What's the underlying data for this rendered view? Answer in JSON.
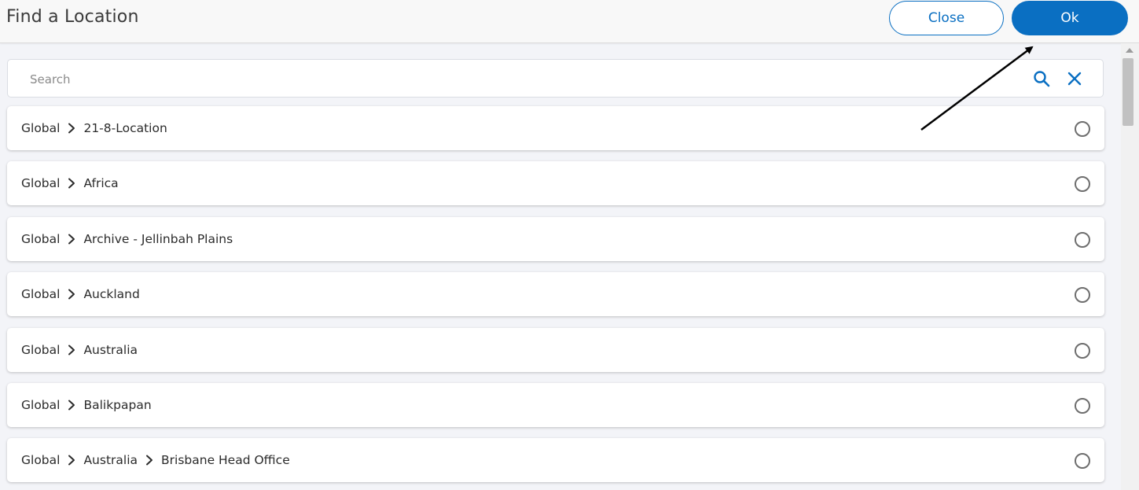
{
  "header": {
    "title": "Find a Location",
    "close_label": "Close",
    "ok_label": "Ok"
  },
  "search": {
    "placeholder": "Search",
    "value": "",
    "search_icon": "search-icon",
    "clear_icon": "close-icon"
  },
  "locations": [
    {
      "path": [
        "Global",
        "21-8-Location"
      ],
      "selected": false
    },
    {
      "path": [
        "Global",
        "Africa"
      ],
      "selected": false
    },
    {
      "path": [
        "Global",
        "Archive - Jellinbah Plains"
      ],
      "selected": false
    },
    {
      "path": [
        "Global",
        "Auckland"
      ],
      "selected": false
    },
    {
      "path": [
        "Global",
        "Australia"
      ],
      "selected": false
    },
    {
      "path": [
        "Global",
        "Balikpapan"
      ],
      "selected": false
    },
    {
      "path": [
        "Global",
        "Australia",
        "Brisbane Head Office"
      ],
      "selected": false
    }
  ],
  "colors": {
    "accent": "#0a6fc2",
    "background": "#f3f4f8",
    "row_background": "#ffffff"
  },
  "annotation": {
    "type": "arrow",
    "points_to": "ok-button",
    "color": "#000000"
  }
}
